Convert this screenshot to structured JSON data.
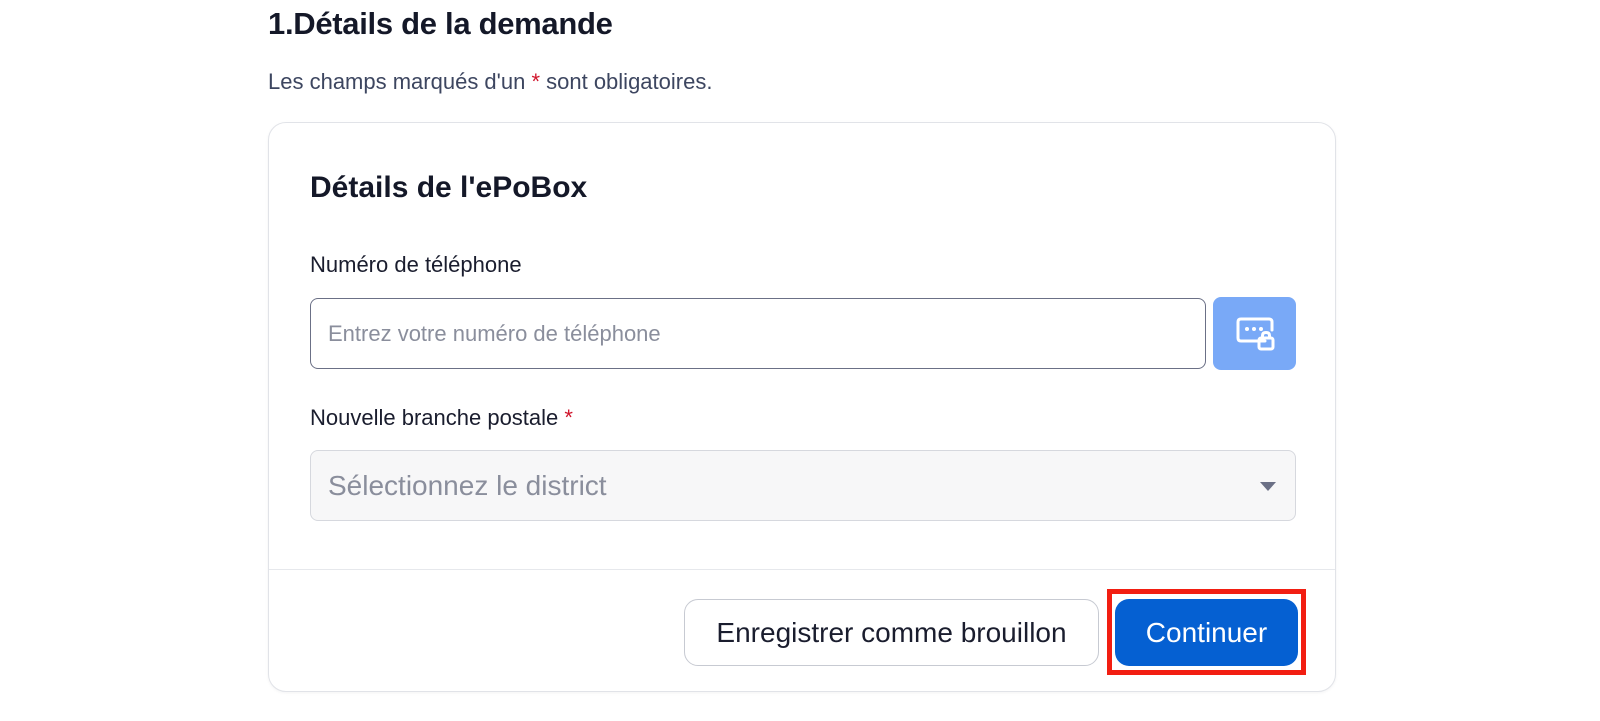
{
  "section": {
    "title": "1.Détails de la demande",
    "required_note_before": "Les champs marqués d'un ",
    "required_asterisk": "*",
    "required_note_after": " sont obligatoires."
  },
  "card": {
    "title": "Détails de l'ePoBox",
    "phone": {
      "label": "Numéro de téléphone",
      "placeholder": "Entrez votre numéro de téléphone",
      "value": "",
      "action_icon": "password-lock-icon"
    },
    "branch": {
      "label": "Nouvelle branche postale",
      "required_asterisk": "*",
      "placeholder": "Sélectionnez le district",
      "dropdown_icon": "chevron-down-icon"
    }
  },
  "actions": {
    "save_draft_label": "Enregistrer comme brouillon",
    "continue_label": "Continuer"
  },
  "colors": {
    "primary": "#0560d2",
    "icon_button": "#79a9f7",
    "required": "#d0142b",
    "highlight": "#f21e12"
  }
}
